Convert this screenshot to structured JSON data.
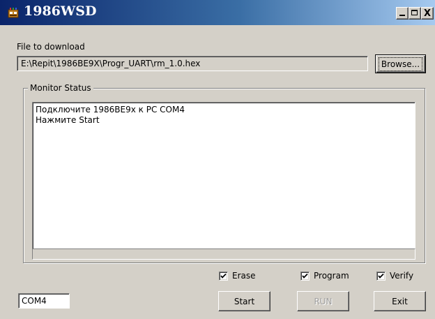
{
  "window": {
    "title": "1986WSD",
    "icon": "app-chip-icon",
    "controls": {
      "minimize": "minimize-icon",
      "maximize": "maximize-icon",
      "close_label": "X"
    }
  },
  "file": {
    "label": "File to download",
    "path": "E:\\Repit\\1986BE9X\\Progr_UART\\rm_1.0.hex",
    "browse_label": "Browse..."
  },
  "monitor": {
    "title": "Monitor Status",
    "lines": [
      "Подключите 1986BE9x к PC COM4",
      "Нажмите Start"
    ],
    "progress": 0
  },
  "options": {
    "erase": {
      "label": "Erase",
      "checked": true
    },
    "program": {
      "label": "Program",
      "checked": true
    },
    "verify": {
      "label": "Verify",
      "checked": true
    }
  },
  "port": {
    "value": "COM4"
  },
  "actions": {
    "start_label": "Start",
    "run_label": "RUN",
    "exit_label": "Exit",
    "run_enabled": false
  },
  "colors": {
    "title_bar_start": "#0a246a",
    "title_bar_end": "#a6caf0",
    "face": "#d4d0c8",
    "disabled_text": "#a0a0a0"
  }
}
